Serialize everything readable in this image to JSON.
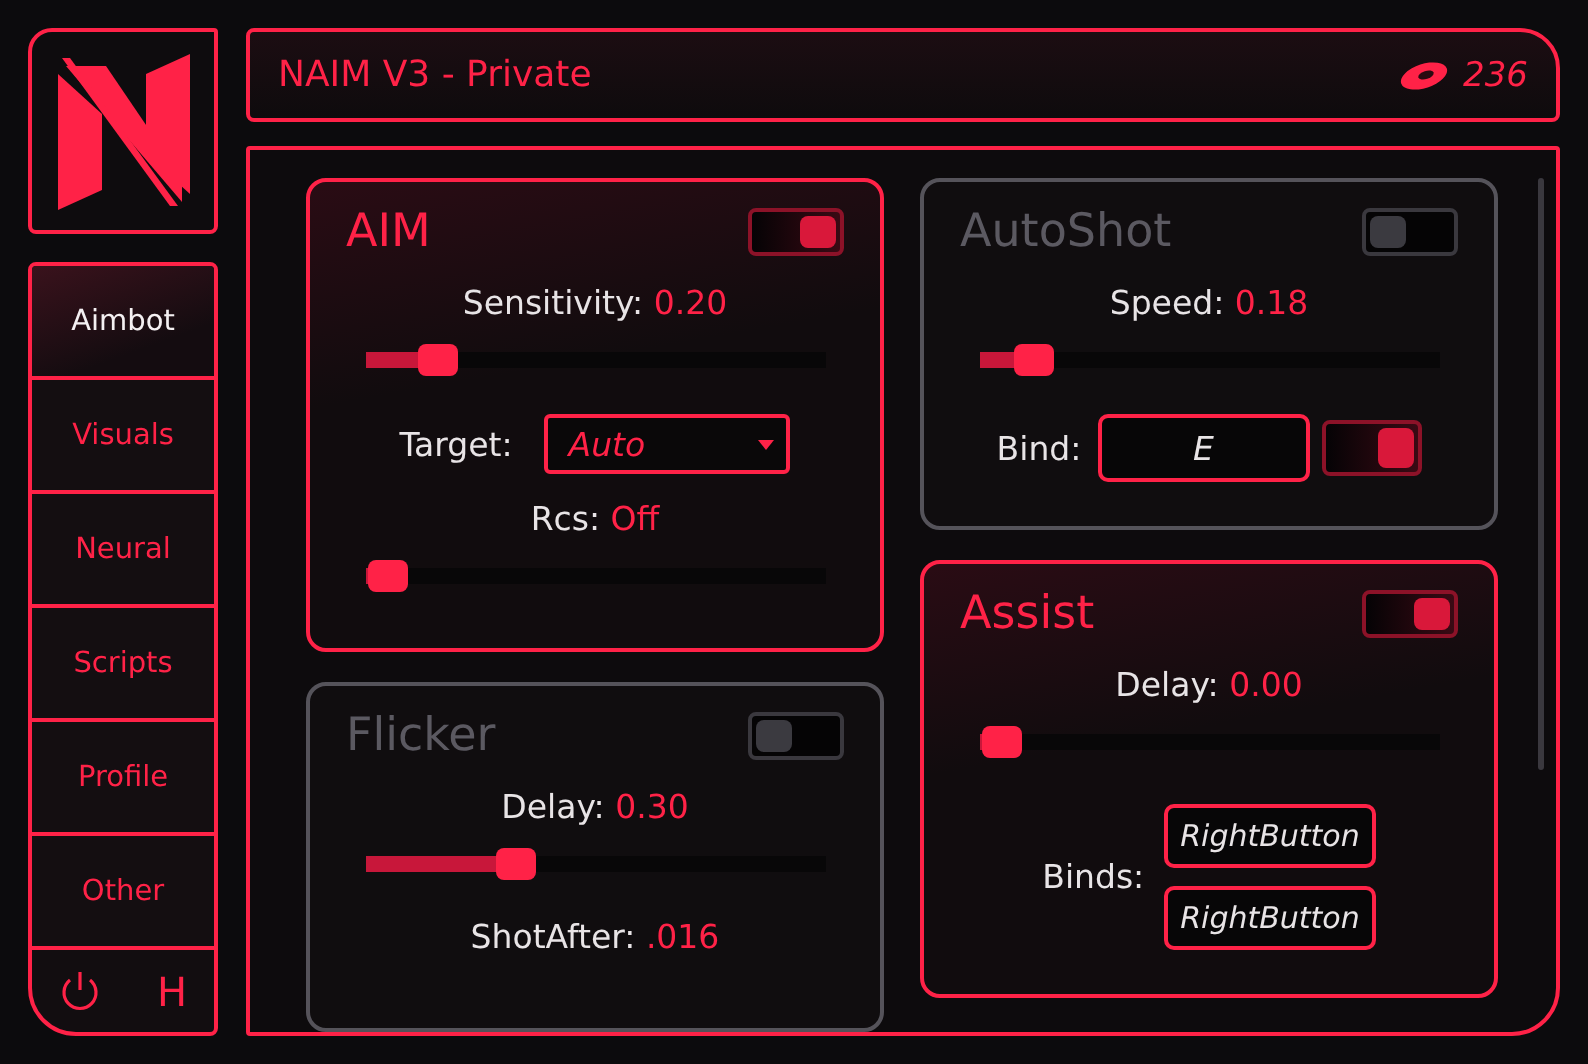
{
  "sidebar": {
    "items": [
      {
        "label": "Aimbot",
        "selected": true
      },
      {
        "label": "Visuals",
        "selected": false
      },
      {
        "label": "Neural",
        "selected": false
      },
      {
        "label": "Scripts",
        "selected": false
      },
      {
        "label": "Profile",
        "selected": false
      },
      {
        "label": "Other",
        "selected": false
      }
    ],
    "footer_key": "H"
  },
  "header": {
    "title": "NAIM V3 - Private",
    "views": "236"
  },
  "columns": [
    [
      {
        "title": "AIM",
        "enabled": true,
        "controls": [
          {
            "kind": "slider",
            "label": "Sensitivity:",
            "value": "0.20",
            "level": 0.16
          },
          {
            "kind": "dropdown",
            "label": "Target:",
            "value": "Auto"
          },
          {
            "kind": "slider",
            "label": "Rcs:",
            "value": "Off",
            "level": 0.05
          }
        ]
      },
      {
        "title": "Flicker",
        "enabled": false,
        "controls": [
          {
            "kind": "slider",
            "label": "Delay:",
            "value": "0.30",
            "level": 0.33
          },
          {
            "kind": "reading",
            "label": "ShotAfter:",
            "value": ".016"
          }
        ]
      }
    ],
    [
      {
        "title": "AutoShot",
        "enabled": false,
        "controls": [
          {
            "kind": "slider",
            "label": "Speed:",
            "value": "0.18",
            "level": 0.12
          },
          {
            "kind": "bind",
            "label": "Bind:",
            "value": "E",
            "on": true
          }
        ]
      },
      {
        "title": "Assist",
        "enabled": true,
        "controls": [
          {
            "kind": "slider",
            "label": "Delay:",
            "value": "0.00",
            "level": 0.05
          },
          {
            "kind": "binds",
            "label": "Binds:",
            "values": [
              "RightButton",
              "RightButton"
            ]
          }
        ]
      }
    ]
  ]
}
